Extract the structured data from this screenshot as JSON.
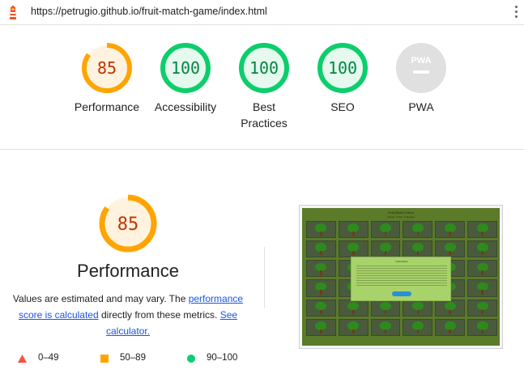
{
  "topbar": {
    "url": "https://petrugio.github.io/fruit-match-game/index.html",
    "logo_icon": "lighthouse-icon",
    "menu_icon": "more-vertical-icon"
  },
  "summary": {
    "categories": [
      {
        "score": "85",
        "label": "Performance",
        "status": "average",
        "value": 0.85
      },
      {
        "score": "100",
        "label": "Accessibility",
        "status": "pass",
        "value": 1.0
      },
      {
        "score": "100",
        "label": "Best Practices",
        "status": "pass",
        "value": 1.0
      },
      {
        "score": "100",
        "label": "SEO",
        "status": "pass",
        "value": 1.0
      },
      {
        "score": "PWA",
        "label": "PWA",
        "status": "na",
        "value": 0
      }
    ]
  },
  "performance": {
    "score": "85",
    "value": 0.85,
    "title": "Performance",
    "desc_prefix": "Values are estimated and may vary. The ",
    "desc_link1": "performance score is calculated",
    "desc_mid": " directly from these metrics. ",
    "desc_link2": "See calculator."
  },
  "legend": [
    {
      "range": "0–49",
      "shape": "triangle"
    },
    {
      "range": "50–89",
      "shape": "square"
    },
    {
      "range": "90–100",
      "shape": "circle"
    }
  ],
  "colors": {
    "fail": "#ff4e42",
    "average": "#ffa400",
    "average_text": "#c33300",
    "average_bg": "#fff3e0",
    "pass": "#0cce6b",
    "pass_text": "#018642",
    "pass_bg": "#e5f9ee",
    "na": "#e0e0e0",
    "link": "#1a55e3"
  },
  "screenshot": {
    "title": "Fruit Match Game",
    "subtitle": "Moves: 0   Time: 0   Restart",
    "modal_title": "Instructions"
  }
}
